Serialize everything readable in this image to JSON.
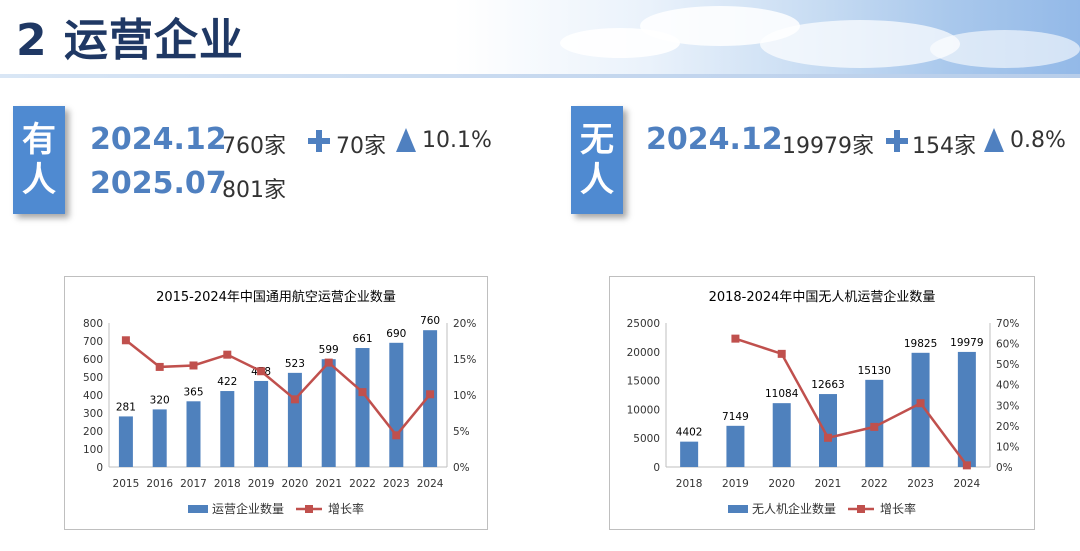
{
  "page_title": "2 运营企业",
  "manned": {
    "tag": [
      "有",
      "人"
    ],
    "rows": [
      {
        "date": "2024.12",
        "count": "760家",
        "increase": "70家",
        "growth": "10.1%"
      },
      {
        "date": "2025.07",
        "count": "801家"
      }
    ]
  },
  "unmanned": {
    "tag": [
      "无",
      "人"
    ],
    "rows": [
      {
        "date": "2024.12",
        "count": "19979家",
        "increase": "154家",
        "growth": "0.8%"
      }
    ]
  },
  "colors": {
    "bar": "#4f81bd",
    "line": "#c0504d",
    "accent": "#4f80c0",
    "title": "#1f3864"
  },
  "chart_data": [
    {
      "type": "bar",
      "title": "2015-2024年中国通用航空运营企业数量",
      "categories": [
        "2015",
        "2016",
        "2017",
        "2018",
        "2019",
        "2020",
        "2021",
        "2022",
        "2023",
        "2024"
      ],
      "series": [
        {
          "name": "运营企业数量",
          "kind": "bar",
          "axis": "left",
          "values": [
            281,
            320,
            365,
            422,
            478,
            523,
            599,
            661,
            690,
            760
          ],
          "labels": [
            "281",
            "320",
            "365",
            "422",
            "478",
            "523",
            "599",
            "661",
            "690",
            "760"
          ]
        },
        {
          "name": "增长率",
          "kind": "line",
          "axis": "right",
          "values": [
            17.6,
            13.9,
            14.1,
            15.6,
            13.3,
            9.4,
            14.5,
            10.4,
            4.4,
            10.1
          ]
        }
      ],
      "ylim": [
        0,
        800
      ],
      "yticks": [
        "0",
        "100",
        "200",
        "300",
        "400",
        "500",
        "600",
        "700",
        "800"
      ],
      "y2lim": [
        0,
        20
      ],
      "y2ticks": [
        "0%",
        "5%",
        "10%",
        "15%",
        "20%"
      ],
      "legend": "bottom"
    },
    {
      "type": "bar",
      "title": "2018-2024年中国无人机运营企业数量",
      "categories": [
        "2018",
        "2019",
        "2020",
        "2021",
        "2022",
        "2023",
        "2024"
      ],
      "series": [
        {
          "name": "无人机企业数量",
          "kind": "bar",
          "axis": "left",
          "values": [
            4402,
            7149,
            11084,
            12663,
            15130,
            19825,
            19979
          ],
          "labels": [
            "4402",
            "7149",
            "11084",
            "12663",
            "15130",
            "19825",
            "19979"
          ]
        },
        {
          "name": "增长率",
          "kind": "line",
          "axis": "right",
          "values": [
            null,
            62.4,
            55.0,
            14.2,
            19.5,
            31.0,
            0.8
          ]
        }
      ],
      "ylim": [
        0,
        25000
      ],
      "yticks": [
        "0",
        "5000",
        "10000",
        "15000",
        "20000",
        "25000"
      ],
      "y2lim": [
        0,
        70
      ],
      "y2ticks": [
        "0%",
        "10%",
        "20%",
        "30%",
        "40%",
        "50%",
        "60%",
        "70%"
      ],
      "legend": "bottom"
    }
  ]
}
